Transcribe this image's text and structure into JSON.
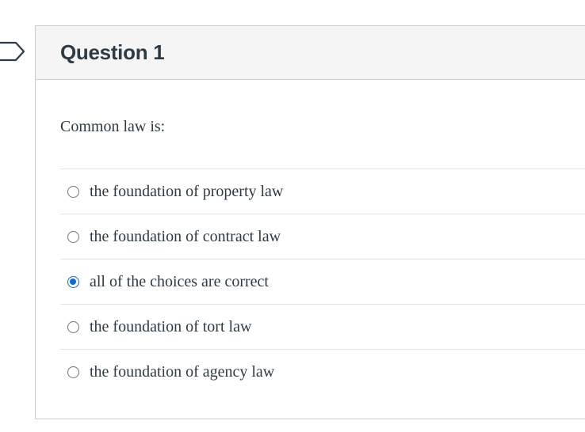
{
  "question": {
    "title": "Question 1",
    "text": "Common law is:",
    "answers": [
      {
        "label": "the foundation of property law",
        "selected": false
      },
      {
        "label": "the foundation of contract law",
        "selected": false
      },
      {
        "label": "all of the choices are correct",
        "selected": true
      },
      {
        "label": "the foundation of tort law",
        "selected": false
      },
      {
        "label": "the foundation of agency law",
        "selected": false
      }
    ]
  },
  "colors": {
    "accent": "#0b6bd7",
    "text": "#2d3b45",
    "header_bg": "#f5f5f5",
    "border": "#c7cdd1"
  }
}
